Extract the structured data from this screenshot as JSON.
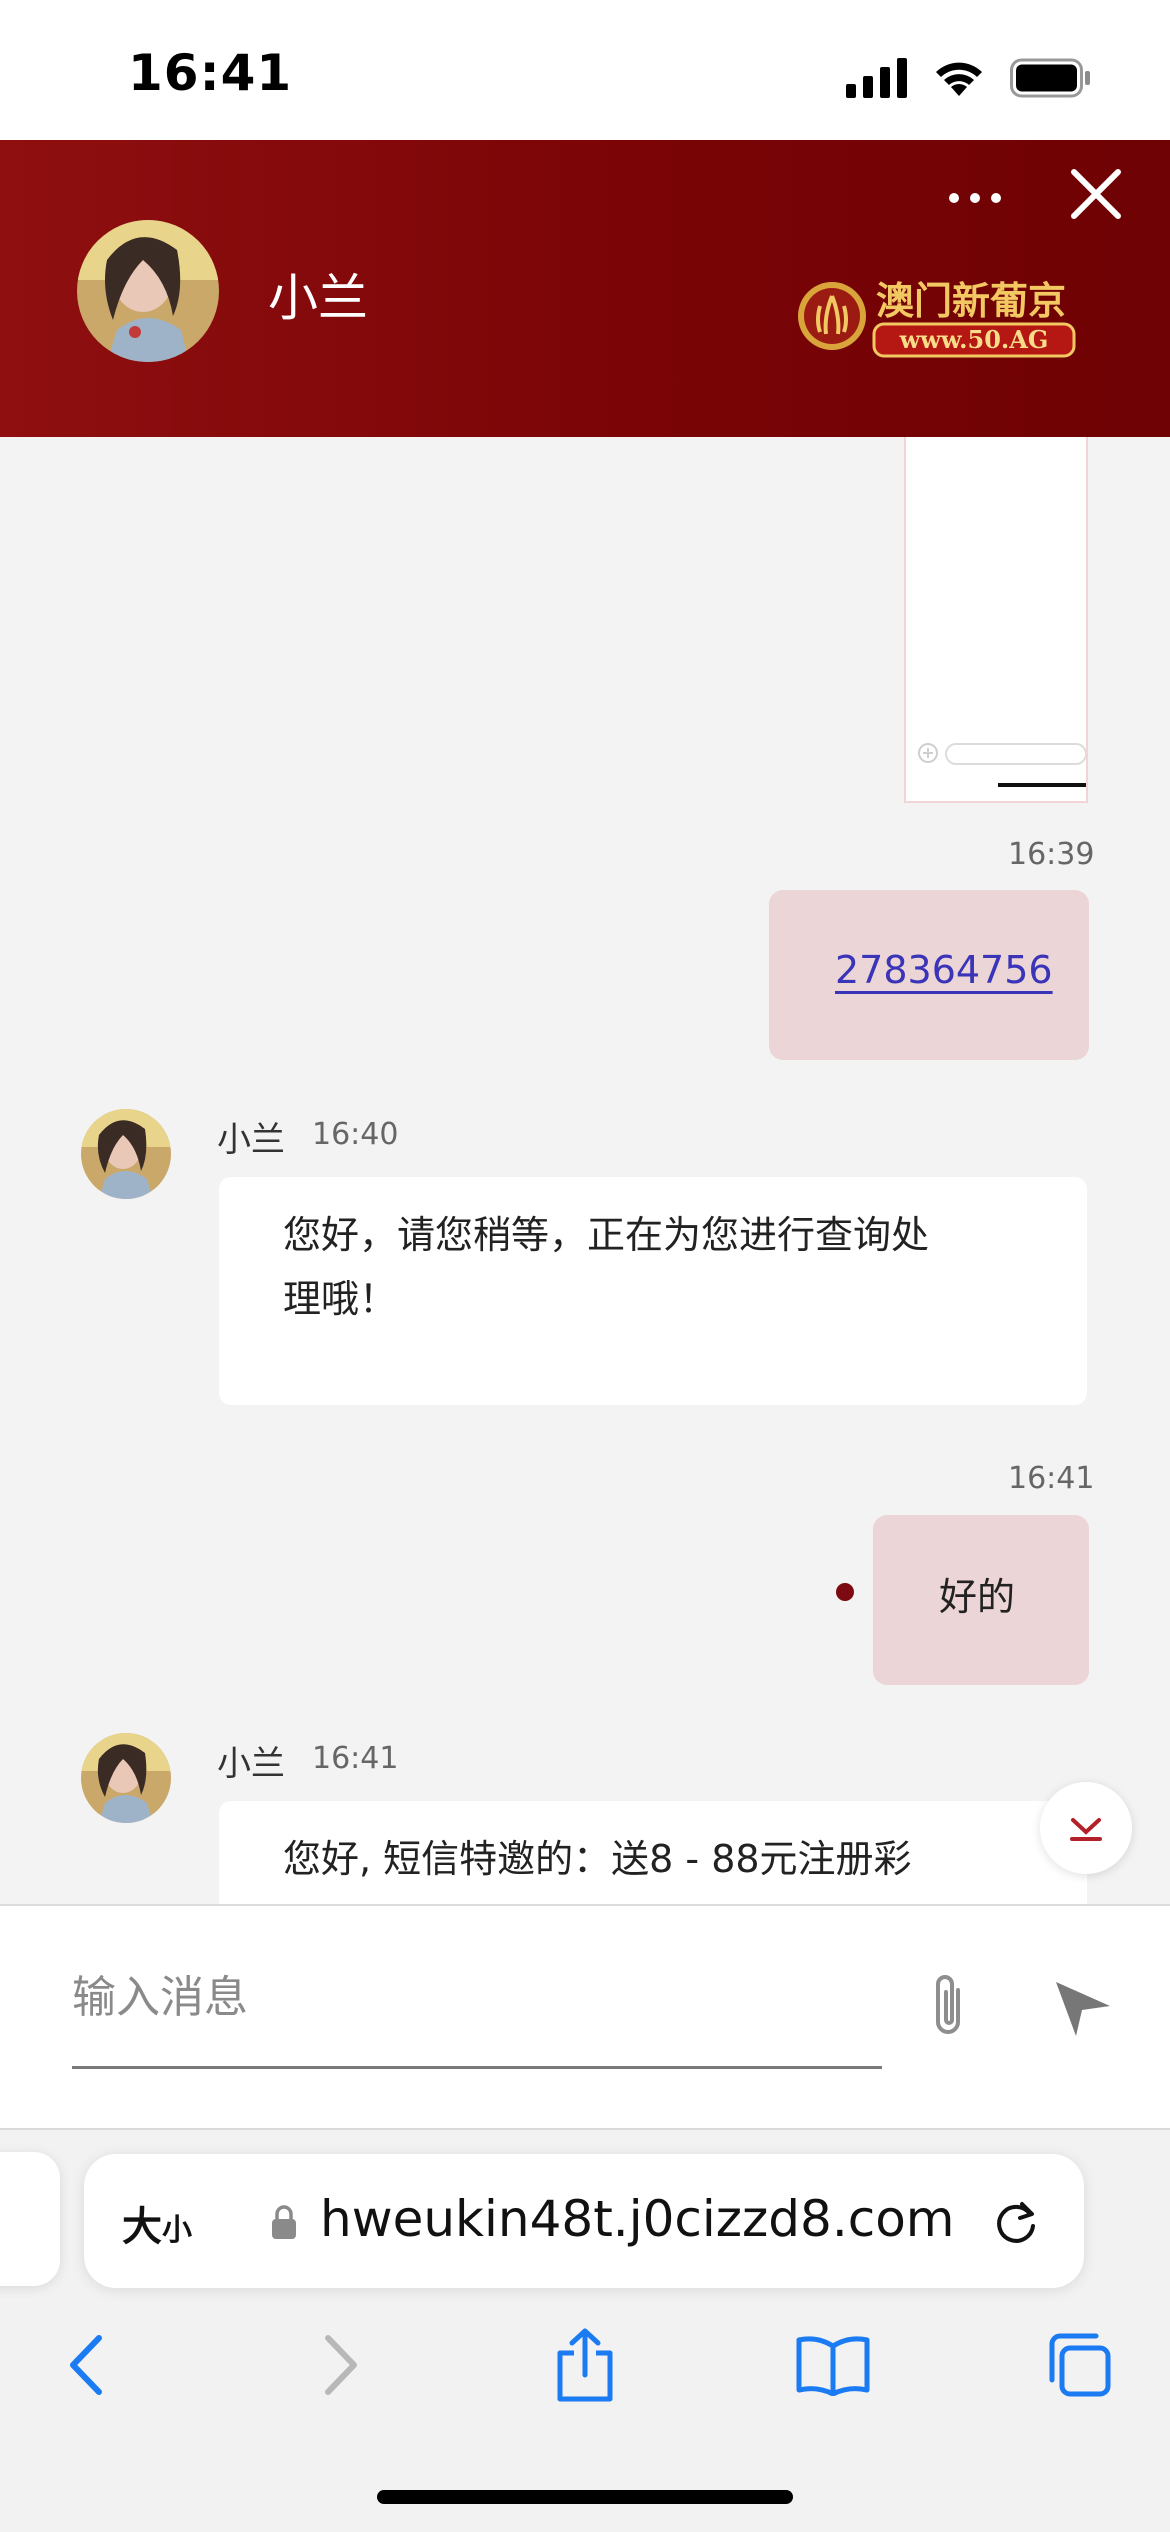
{
  "status_bar": {
    "time": "16:41"
  },
  "header": {
    "contact_name": "小兰",
    "brand_name": "澳门新葡京",
    "brand_url": "www.50.AG"
  },
  "messages": [
    {
      "type": "image",
      "direction": "out"
    },
    {
      "direction": "out",
      "time": "16:39",
      "text": "278364756",
      "is_link": true
    },
    {
      "direction": "in",
      "sender": "小兰",
      "time": "16:40",
      "text_line1": "您好，请您稍等，正在为您进行查询处",
      "text_line2": "理哦！"
    },
    {
      "direction": "out",
      "time": "16:41",
      "text": "好的"
    },
    {
      "direction": "in",
      "sender": "小兰",
      "time": "16:41",
      "text_line1": "您好, 短信特邀的：送8 - 88元注册彩"
    }
  ],
  "input": {
    "placeholder": "输入消息"
  },
  "browser": {
    "text_size_label": "大",
    "text_size_small": "小",
    "url": "hweukin48t.j0cizzd8.com"
  },
  "colors": {
    "header": "#7a0406",
    "out_bubble": "#ecd5d7",
    "link": "#3a34b8",
    "ios_blue": "#1a7bf2"
  }
}
